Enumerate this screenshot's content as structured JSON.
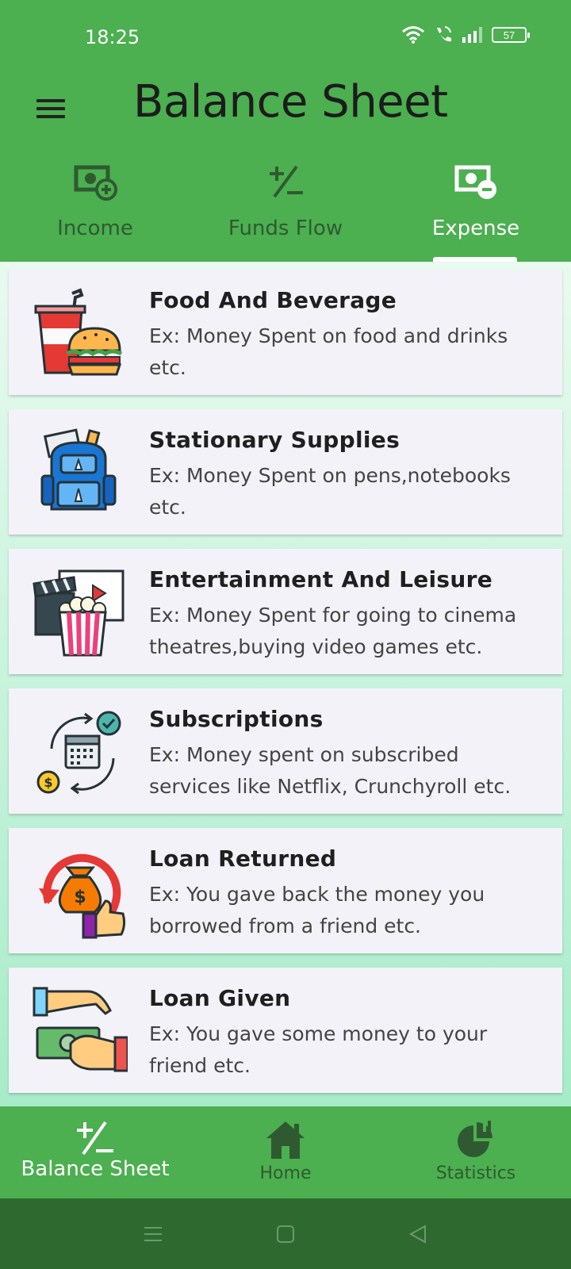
{
  "status_bar": {
    "time": "18:25",
    "battery": "57"
  },
  "app_bar": {
    "title": "Balance Sheet"
  },
  "tabs": [
    {
      "label": "Income",
      "icon": "money-plus-icon",
      "active": false
    },
    {
      "label": "Funds Flow",
      "icon": "plus-minus-icon",
      "active": false
    },
    {
      "label": "Expense",
      "icon": "money-minus-icon",
      "active": true
    }
  ],
  "categories": [
    {
      "title": "Food And Beverage",
      "desc": "Ex: Money Spent on food and drinks etc.",
      "icon": "burger-drink-icon"
    },
    {
      "title": "Stationary Supplies",
      "desc": "Ex: Money Spent on pens,notebooks etc.",
      "icon": "backpack-icon"
    },
    {
      "title": "Entertainment And Leisure",
      "desc": "Ex: Money Spent for going to cinema theatres,buying video games etc.",
      "icon": "cinema-popcorn-icon"
    },
    {
      "title": "Subscriptions",
      "desc": "Ex: Money spent on subscribed services like Netflix, Crunchyroll etc.",
      "icon": "calendar-cycle-icon"
    },
    {
      "title": "Loan Returned",
      "desc": "Ex: You gave back the money you borrowed from a friend etc.",
      "icon": "money-bag-return-icon"
    },
    {
      "title": "Loan Given",
      "desc": "Ex: You gave some money to your friend etc.",
      "icon": "hand-cash-icon"
    }
  ],
  "bottom_nav": [
    {
      "label": "Balance Sheet",
      "icon": "plus-minus-icon",
      "active": true
    },
    {
      "label": "Home",
      "icon": "home-icon",
      "active": false
    },
    {
      "label": "Statistics",
      "icon": "pie-chart-icon",
      "active": false
    }
  ],
  "colors": {
    "primary": "#4caf50",
    "nav_bar": "#2e6a30",
    "card_bg": "#f4f2f9",
    "content_bg": "#e9faf0"
  }
}
